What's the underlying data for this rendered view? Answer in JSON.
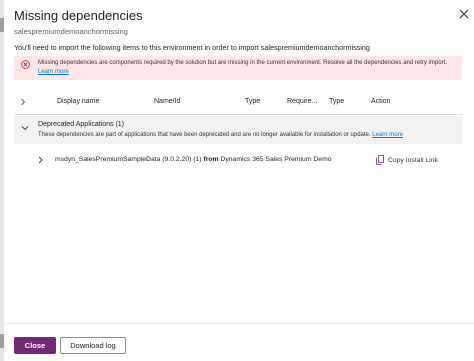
{
  "dialog": {
    "title": "Missing dependencies",
    "subtitle": "salespremiumdemoanchormissing",
    "intro": "You'll need to import the following items to this environment in order to import salespremiumdemoanchormissing"
  },
  "error_banner": {
    "text": "Missing dependencies are components required by the solution but are missing in the current environment. Resolve all the dependencies and retry import.",
    "link": "Learn more",
    "icon": "error-circle-icon",
    "color": "#a4262c"
  },
  "table": {
    "columns": [
      "Display name",
      "Name/Id",
      "Type",
      "Require...",
      "Type",
      "Action"
    ]
  },
  "group": {
    "title": "Deprecated Applications (1)",
    "description": "These dependencies are part of applications that have been deprecated and are no longer available for installation or update.",
    "link": "Learn more"
  },
  "row": {
    "name": "msdyn_SalesPremiumSampleData (9.0.2.20) (1)",
    "from_label": "from",
    "source": "Dynamics 365 Sales Premium Demo",
    "action": "Copy Install Link",
    "action_icon": "copy-icon"
  },
  "footer": {
    "close": "Close",
    "download": "Download log",
    "accent": "#742774"
  }
}
